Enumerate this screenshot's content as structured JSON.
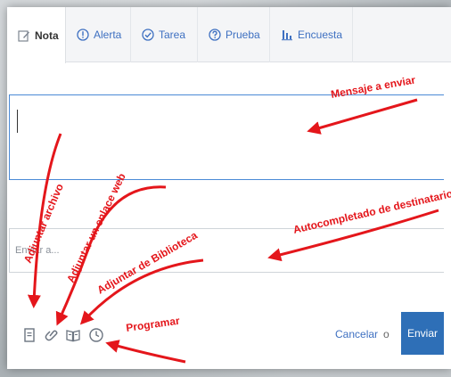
{
  "tabs": [
    {
      "label": "Nota",
      "icon": "note-edit-icon"
    },
    {
      "label": "Alerta",
      "icon": "alert-icon"
    },
    {
      "label": "Tarea",
      "icon": "check-circle-icon"
    },
    {
      "label": "Prueba",
      "icon": "question-icon"
    },
    {
      "label": "Encuesta",
      "icon": "bar-chart-icon"
    }
  ],
  "composer": {
    "to_placeholder": "Enviar a...",
    "tools": [
      "attach-file-icon",
      "attach-link-icon",
      "library-icon",
      "schedule-clock-icon"
    ],
    "cancel_label": "Cancelar",
    "or_label": "o",
    "send_label": "Enviar"
  },
  "annotations": {
    "message": "Mensaje a enviar",
    "attach_file": "Adjuntar archivo",
    "attach_link": "Adjuntar un enlace web",
    "attach_library": "Adjuntar de Biblioteca",
    "schedule": "Programar",
    "autocomplete": "Autocompletado de destinatarios"
  },
  "colors": {
    "link": "#3e70c1",
    "send_button": "#2e6fb7",
    "annotation": "#e4161b",
    "focus_border": "#4a8ad6"
  }
}
